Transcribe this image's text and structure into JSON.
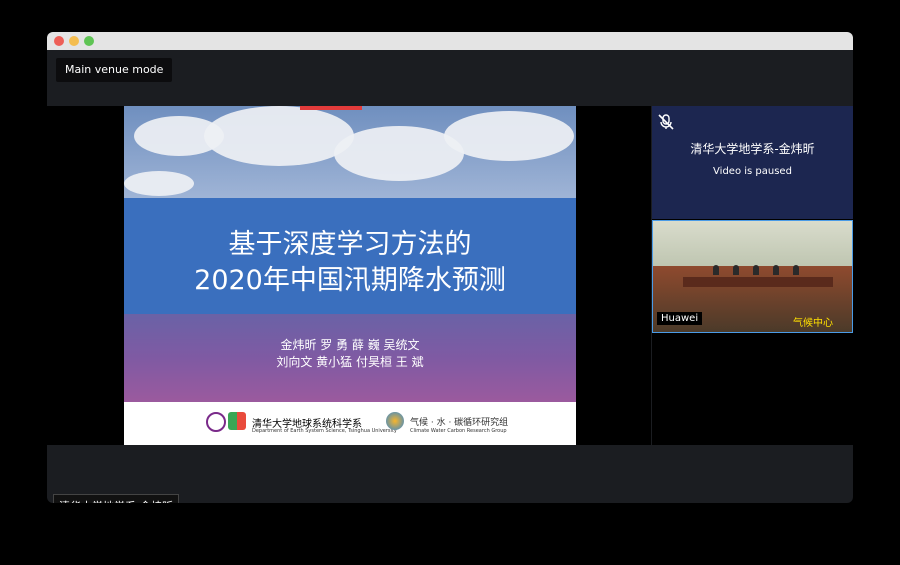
{
  "toolbar": {
    "mode_label": "Main venue mode"
  },
  "slide": {
    "title_line1": "基于深度学习方法的",
    "title_line2": "2020年中国汛期降水预测",
    "authors_line1": "金炜昕   罗   勇   薛 巍   吴统文",
    "authors_line2": "刘向文   黄小猛   付昊桓   王   斌",
    "footer_left": "清华大学地球系统科学系",
    "footer_left_sub": "Department of Earth System Science, Tsinghua University",
    "footer_right": "气候 · 水 · 碳循环研究组",
    "footer_right_sub": "Climate Water Carbon Research Group"
  },
  "main_speaker": {
    "name": "清华大学地学系-金炜昕"
  },
  "participants": [
    {
      "name": "清华大学地学系-金炜昕",
      "status": "Video is paused",
      "icon": "mic-muted-icon"
    },
    {
      "name": "Huawei",
      "overlay": "气候中心"
    }
  ],
  "colors": {
    "accent": "#4a9be6",
    "tile_bg": "#1c2650",
    "band": "#3a6fbe"
  }
}
